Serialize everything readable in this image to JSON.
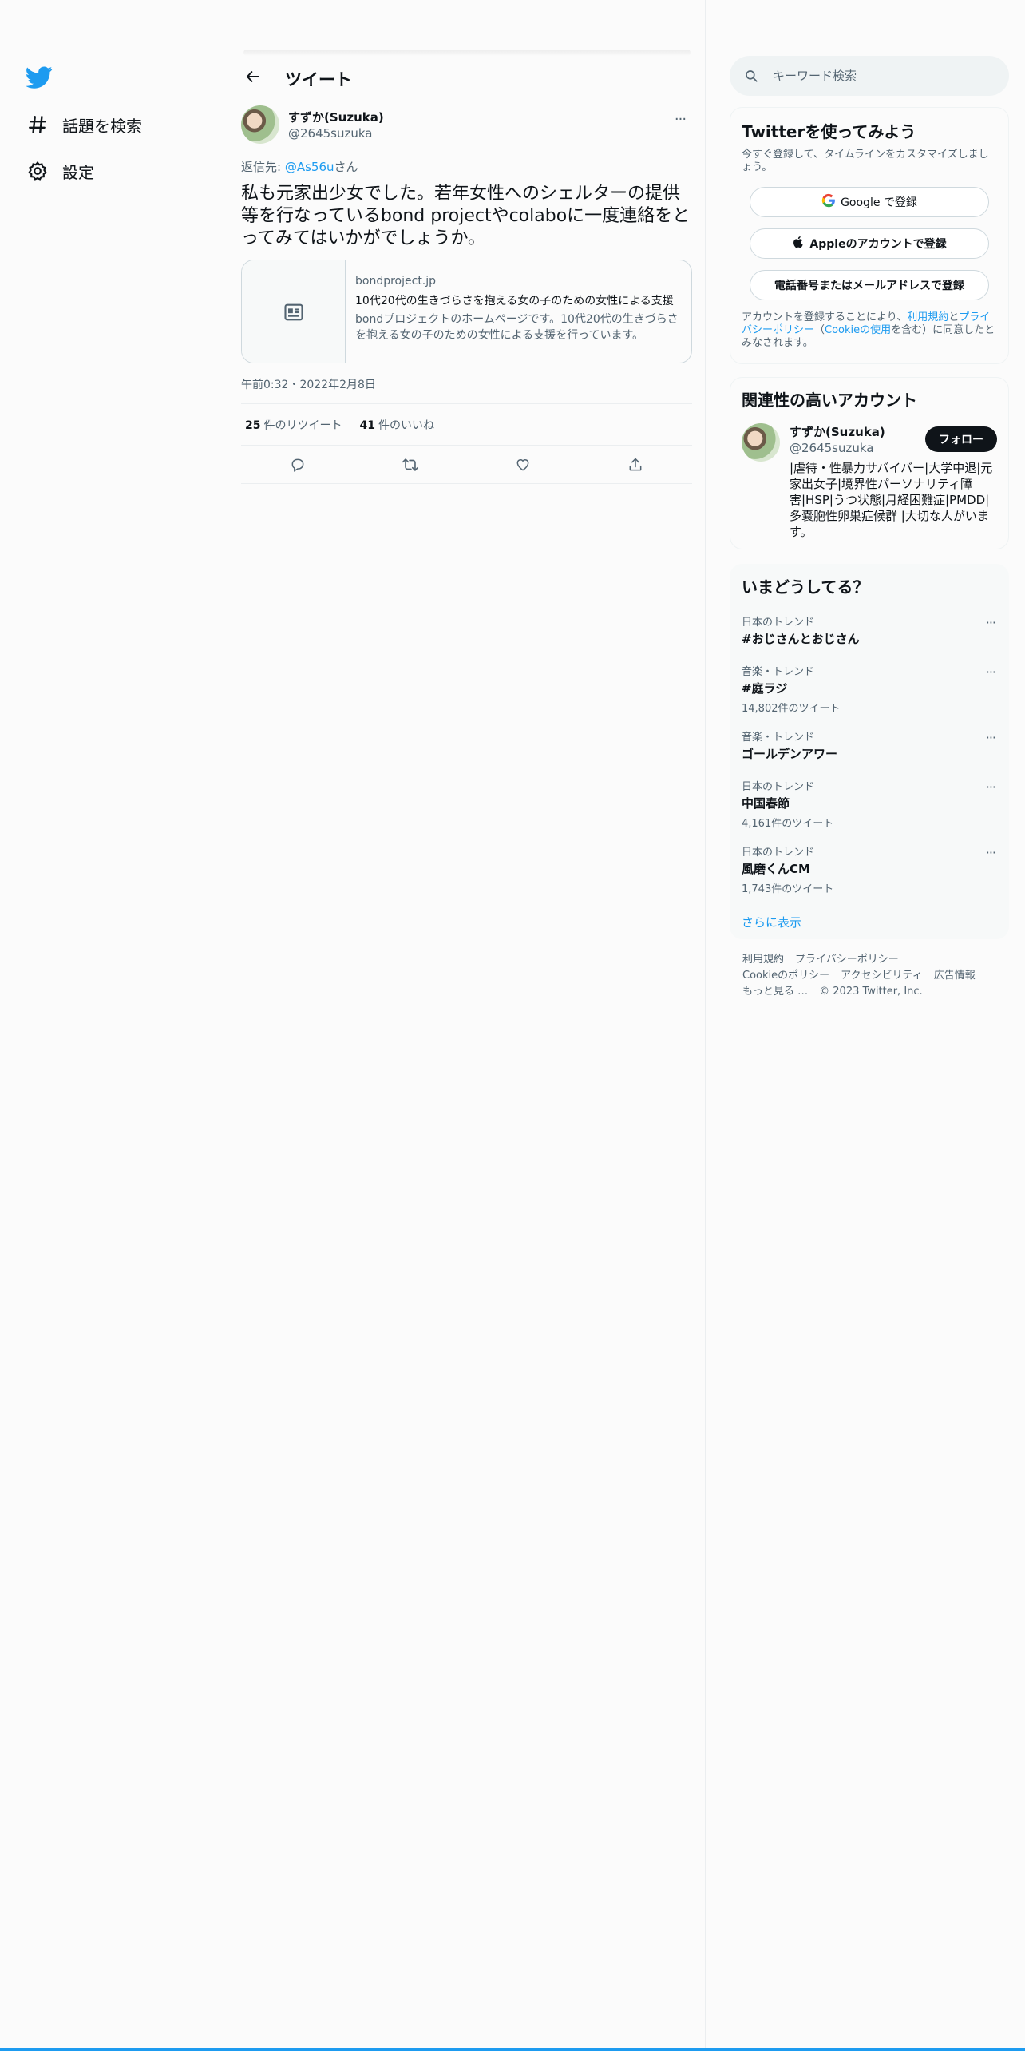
{
  "nav": {
    "explore_label": "話題を検索",
    "settings_label": "設定"
  },
  "header": {
    "title": "ツイート"
  },
  "tweet": {
    "author_name": "すずか(Suzuka)",
    "author_handle": "@2645suzuka",
    "more": "···",
    "reply_prefix": "返信先: ",
    "reply_mention": "@As56u",
    "reply_suffix": "さん",
    "text": "私も元家出少女でした。若年女性へのシェルターの提供等を行なっているbond projectやcolaboに一度連絡をとってみてはいかがでしょうか。",
    "card": {
      "domain": "bondproject.jp",
      "title": "10代20代の生きづらさを抱える女の子のための女性による支援",
      "description": "bondプロジェクトのホームページです。10代20代の生きづらさを抱える女の子のための女性による支援を行っています。"
    },
    "timestamp": "午前0:32・2022年2月8日",
    "retweets_count": "25",
    "retweets_label": "件のリツイート",
    "likes_count": "41",
    "likes_label": "件のいいね"
  },
  "search": {
    "placeholder": "キーワード検索"
  },
  "signup": {
    "title": "Twitterを使ってみよう",
    "subtitle": "今すぐ登録して、タイムラインをカスタマイズしましょう。",
    "google_label": "Google で登録",
    "apple_label": "Appleのアカウントで登録",
    "phone_label": "電話番号またはメールアドレスで登録",
    "terms_prefix": "アカウントを登録することにより、",
    "terms_link": "利用規約",
    "terms_and": "と",
    "privacy_link": "プライバシーポリシー",
    "terms_paren_open": "（",
    "cookie_link": "Cookieの使用",
    "terms_suffix": "を含む）に同意したとみなされます。"
  },
  "related": {
    "title": "関連性の高いアカウント",
    "name": "すずか(Suzuka)",
    "handle": "@2645suzuka",
    "follow_label": "フォロー",
    "bio": "|虐待・性暴力サバイバー|大学中退|元家出女子|境界性パーソナリティ障害|HSP|うつ状態|月経困難症|PMDD|多嚢胞性卵巣症候群 |大切な人がいます。"
  },
  "trends": {
    "title": "いまどうしてる？",
    "items": [
      {
        "context": "日本のトレンド",
        "name": "#おじさんとおじさん",
        "count": ""
      },
      {
        "context": "音楽・トレンド",
        "name": "#庭ラジ",
        "count": "14,802件のツイート"
      },
      {
        "context": "音楽・トレンド",
        "name": "ゴールデンアワー",
        "count": ""
      },
      {
        "context": "日本のトレンド",
        "name": "中国春節",
        "count": "4,161件のツイート"
      },
      {
        "context": "日本のトレンド",
        "name": "風磨くんCM",
        "count": "1,743件のツイート"
      }
    ],
    "more_icon": "···",
    "show_more": "さらに表示"
  },
  "footer": {
    "terms": "利用規約",
    "privacy": "プライバシーポリシー",
    "cookie": "Cookieのポリシー",
    "accessibility": "アクセシビリティ",
    "ads": "広告情報",
    "more": "もっと見る …",
    "copyright": "© 2023 Twitter, Inc."
  },
  "colors": {
    "accent": "#1d9bf0",
    "text": "#0f1419",
    "muted": "#536471"
  },
  "icons": [
    "twitter-logo-icon",
    "hashtag-icon",
    "gear-icon",
    "back-arrow-icon",
    "article-icon",
    "reply-icon",
    "retweet-icon",
    "like-icon",
    "share-icon",
    "search-icon",
    "google-icon",
    "apple-icon"
  ]
}
